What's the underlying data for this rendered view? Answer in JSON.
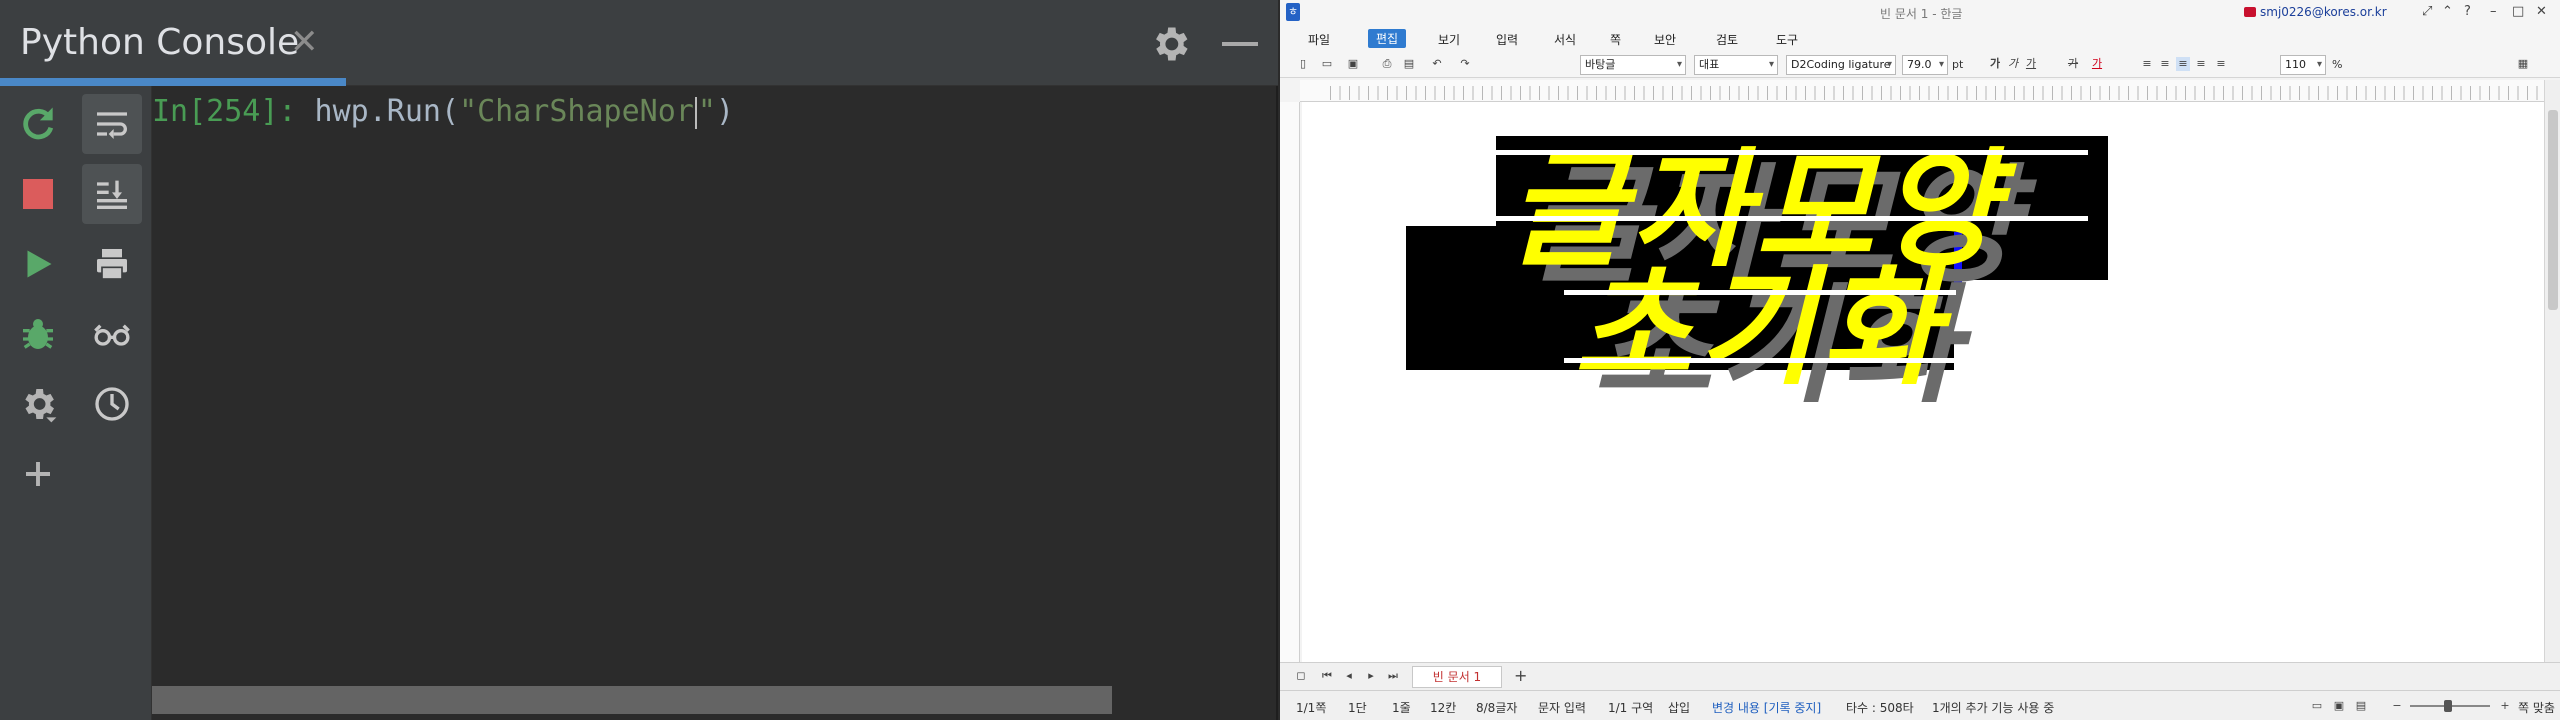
{
  "console": {
    "title": "Python Console",
    "prompt": "In[254]:",
    "code_prefix": " hwp.Run(",
    "string_before_caret": "\"CharShapeNor",
    "string_after_caret": "\"",
    "code_suffix": ")"
  },
  "hwp": {
    "window_title": "빈 문서 1 - 한글",
    "user_account": "smj0226@kores.or.kr",
    "menus": [
      "파일",
      "편집",
      "보기",
      "입력",
      "서식",
      "쪽",
      "보안",
      "검토",
      "도구"
    ],
    "active_menu": "편집",
    "toolbar": {
      "style": "바탕글",
      "lang": "대표",
      "font": "D2Coding ligature",
      "font_size": "79.0",
      "font_unit": "pt",
      "line_spacing": "110",
      "line_spacing_unit": "%"
    },
    "doc_lines": [
      "글자모양",
      "초기화"
    ],
    "doc_tab": "빈 문서 1",
    "status": {
      "page": "1/1쪽",
      "section_col": "1단",
      "line": "1줄",
      "col": "12칸",
      "chars": "8/8글자",
      "input_mode": "문자 입력",
      "zone": "1/1 구역",
      "insert": "삽입",
      "track": "변경 내용 [기록 중지]",
      "count": "타수 : 508타",
      "extra": "1개의 추가 기능 사용 중",
      "zoom_fit": "쪽 맞춤"
    },
    "colors": {
      "text_fill": "#ffff00",
      "background_fill": "#000000",
      "shadow": "#6b6b6b"
    }
  }
}
